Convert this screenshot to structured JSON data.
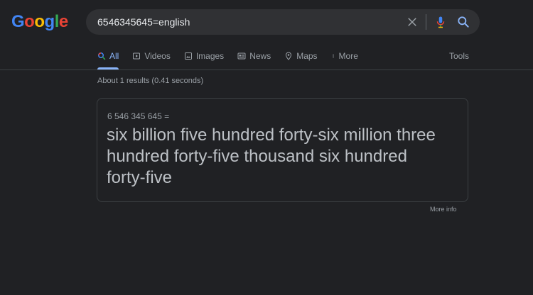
{
  "logo": {
    "text": "Google",
    "letters": [
      {
        "char": "G",
        "color": "#4285f4"
      },
      {
        "char": "o",
        "color": "#ea4335"
      },
      {
        "char": "o",
        "color": "#fbbc05"
      },
      {
        "char": "g",
        "color": "#4285f4"
      },
      {
        "char": "l",
        "color": "#34a853"
      },
      {
        "char": "e",
        "color": "#ea4335"
      }
    ]
  },
  "search": {
    "query": "6546345645=english",
    "icons": {
      "clear": "close-icon",
      "mic": "microphone-icon",
      "submit": "search-icon"
    }
  },
  "tabs": [
    {
      "label": "All",
      "icon": "search-icon",
      "active": true
    },
    {
      "label": "Videos",
      "icon": "video-icon",
      "active": false
    },
    {
      "label": "Images",
      "icon": "image-icon",
      "active": false
    },
    {
      "label": "News",
      "icon": "news-icon",
      "active": false
    },
    {
      "label": "Maps",
      "icon": "map-pin-icon",
      "active": false
    },
    {
      "label": "More",
      "icon": "more-vert-icon",
      "active": false
    }
  ],
  "tools_label": "Tools",
  "result_stats": "About 1 results (0.41 seconds)",
  "answer_card": {
    "expression": "6 546 345 645 =",
    "answer": "six billion five hundred forty-six million three hundred forty-five thousand six hundred forty-five"
  },
  "more_info": "More info",
  "colors": {
    "background": "#202124",
    "search_box": "#303134",
    "accent_blue": "#8ab4f8",
    "text_primary": "#bdc1c6",
    "text_secondary": "#9aa0a6"
  }
}
